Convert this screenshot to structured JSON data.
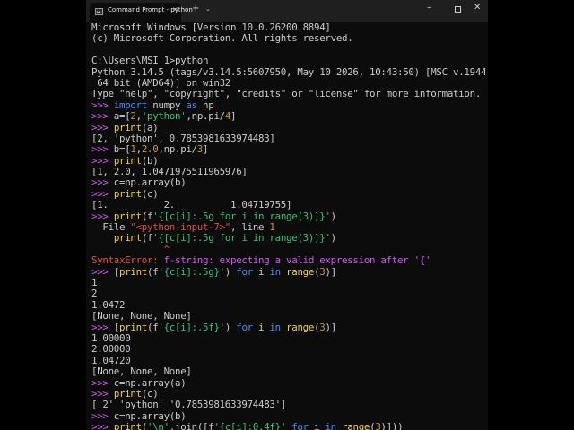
{
  "window": {
    "tab_title": "Command Prompt - python",
    "tab_close": "×",
    "new_tab": "+",
    "dropdown": "⌄",
    "minimize": "–",
    "close": "✕"
  },
  "console_lines": [
    "Microsoft Windows [Version 10.0.26200.8894]",
    "(c) Microsoft Corporation. All rights reserved.",
    "",
    "C:\\Users\\MSI 1>python",
    "Python 3.14.5 (tags/v3.14.5:5607950, May 10 2026, 10:43:50) [MSC v.1944",
    " 64 bit (AMD64)] on win32",
    "Type \"help\", \"copyright\", \"credits\" or \"license\" for more information.",
    ">>> import numpy as np",
    ">>> a=[2,'python',np.pi/4]",
    ">>> print(a)",
    "[2, 'python', 0.7853981633974483]",
    ">>> b=[1,2.0,np.pi/3]",
    ">>> print(b)",
    "[1, 2.0, 1.0471975511965976]",
    ">>> c=np.array(b)",
    ">>> print(c)",
    "[1.          2.          1.04719755]",
    ">>> print(f'{[c[i]:.5g for i in range(3)]}')",
    "  File \"<python-input-7>\", line 1",
    "    print(f'{[c[i]:.5g for i in range(3)]}')",
    "             ^",
    "SyntaxError: f-string: expecting a valid expression after '{'",
    ">>> [print(f'{c[i]:.5g}') for i in range(3)]",
    "1",
    "2",
    "1.0472",
    "[None, None, None]",
    ">>> [print(f'{c[i]:.5f}') for i in range(3)]",
    "1.00000",
    "2.00000",
    "1.04720",
    "[None, None, None]",
    ">>> c=np.array(a)",
    ">>> print(c)",
    "['2' 'python' '0.7853981633974483']",
    ">>> c=np.array(b)",
    ">>> print('\\n'.join([f'{c[i]:0.4f}' for i in range(3)]))"
  ]
}
